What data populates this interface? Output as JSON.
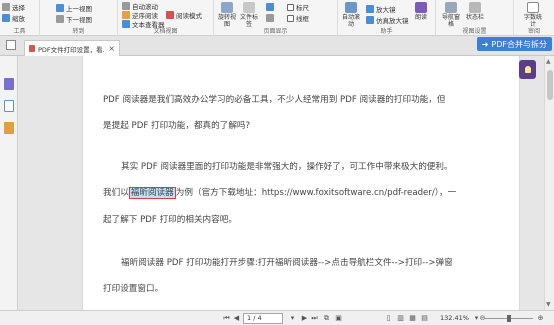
{
  "ribbon": {
    "tools": {
      "select_label": "选择",
      "zoom_label": "缩放",
      "group_label": "工具"
    },
    "goto": {
      "prev_view_label": "上一视图",
      "next_view_label": "下一视图",
      "group_label": "转到"
    },
    "docview": {
      "reflow_label": "逆序阅读",
      "auto_scroll_label": "自动滚动",
      "text_reader_label": "文本查看器",
      "read_mode_label": "阅读模式",
      "group_label": "文档视图"
    },
    "pagedisplay": {
      "rotate_label": "旋转视图",
      "filetab_label": "文件标签",
      "ruler_label": "标尺",
      "grid_label": "网格",
      "guides_label": "线框",
      "group_label": "页面显示"
    },
    "assist": {
      "auto_scroll_label": "自动滚动",
      "magnifier_label": "放大镜",
      "loupe_label": "仿真放大镜",
      "read_label": "朗读",
      "group_label": "助手"
    },
    "viewset": {
      "nav_label": "导航窗格",
      "status_label": "状态栏",
      "group_label": "视图设置"
    },
    "review": {
      "wordcount_label": "字数统计",
      "group_label": "审阅"
    }
  },
  "tabs": {
    "doc_title": "PDF文件打印设置，看...",
    "close_glyph": "×"
  },
  "banner": {
    "label": "PDF合并与拆分"
  },
  "document": {
    "p1_line1": "PDF 阅读器是我们高效办公学习的必备工具，不少人经常用到 PDF 阅读器的打印功能，但",
    "p1_line2": "是提起 PDF 打印功能，都真的了解吗?",
    "p2_line1": "其实 PDF 阅读器里面的打印功能是非常强大的，操作好了，可工作中带来极大的便利。",
    "p2_line2_pre": "我们以",
    "p2_line2_highlight": "福昕阅读器",
    "p2_line2_post": "为例（官方下载地址：https://www.foxitsoftware.cn/pdf-reader/），一",
    "p2_line3": "起了解下 PDF 打印的相关内容吧。",
    "p3_line1": "福昕阅读器 PDF 打印功能打开步骤:打开福昕阅读器-->点击导航栏文件-->打印-->弹窗",
    "p3_line2": "打印设置窗口。"
  },
  "statusbar": {
    "page_value": "1 / 4",
    "zoom_value": "132.41%"
  },
  "colors": {
    "accent": "#3d7fd6",
    "highlight": "#bfe0fb",
    "outline": "#e03a3a",
    "lamp": "#5a3e8c"
  }
}
